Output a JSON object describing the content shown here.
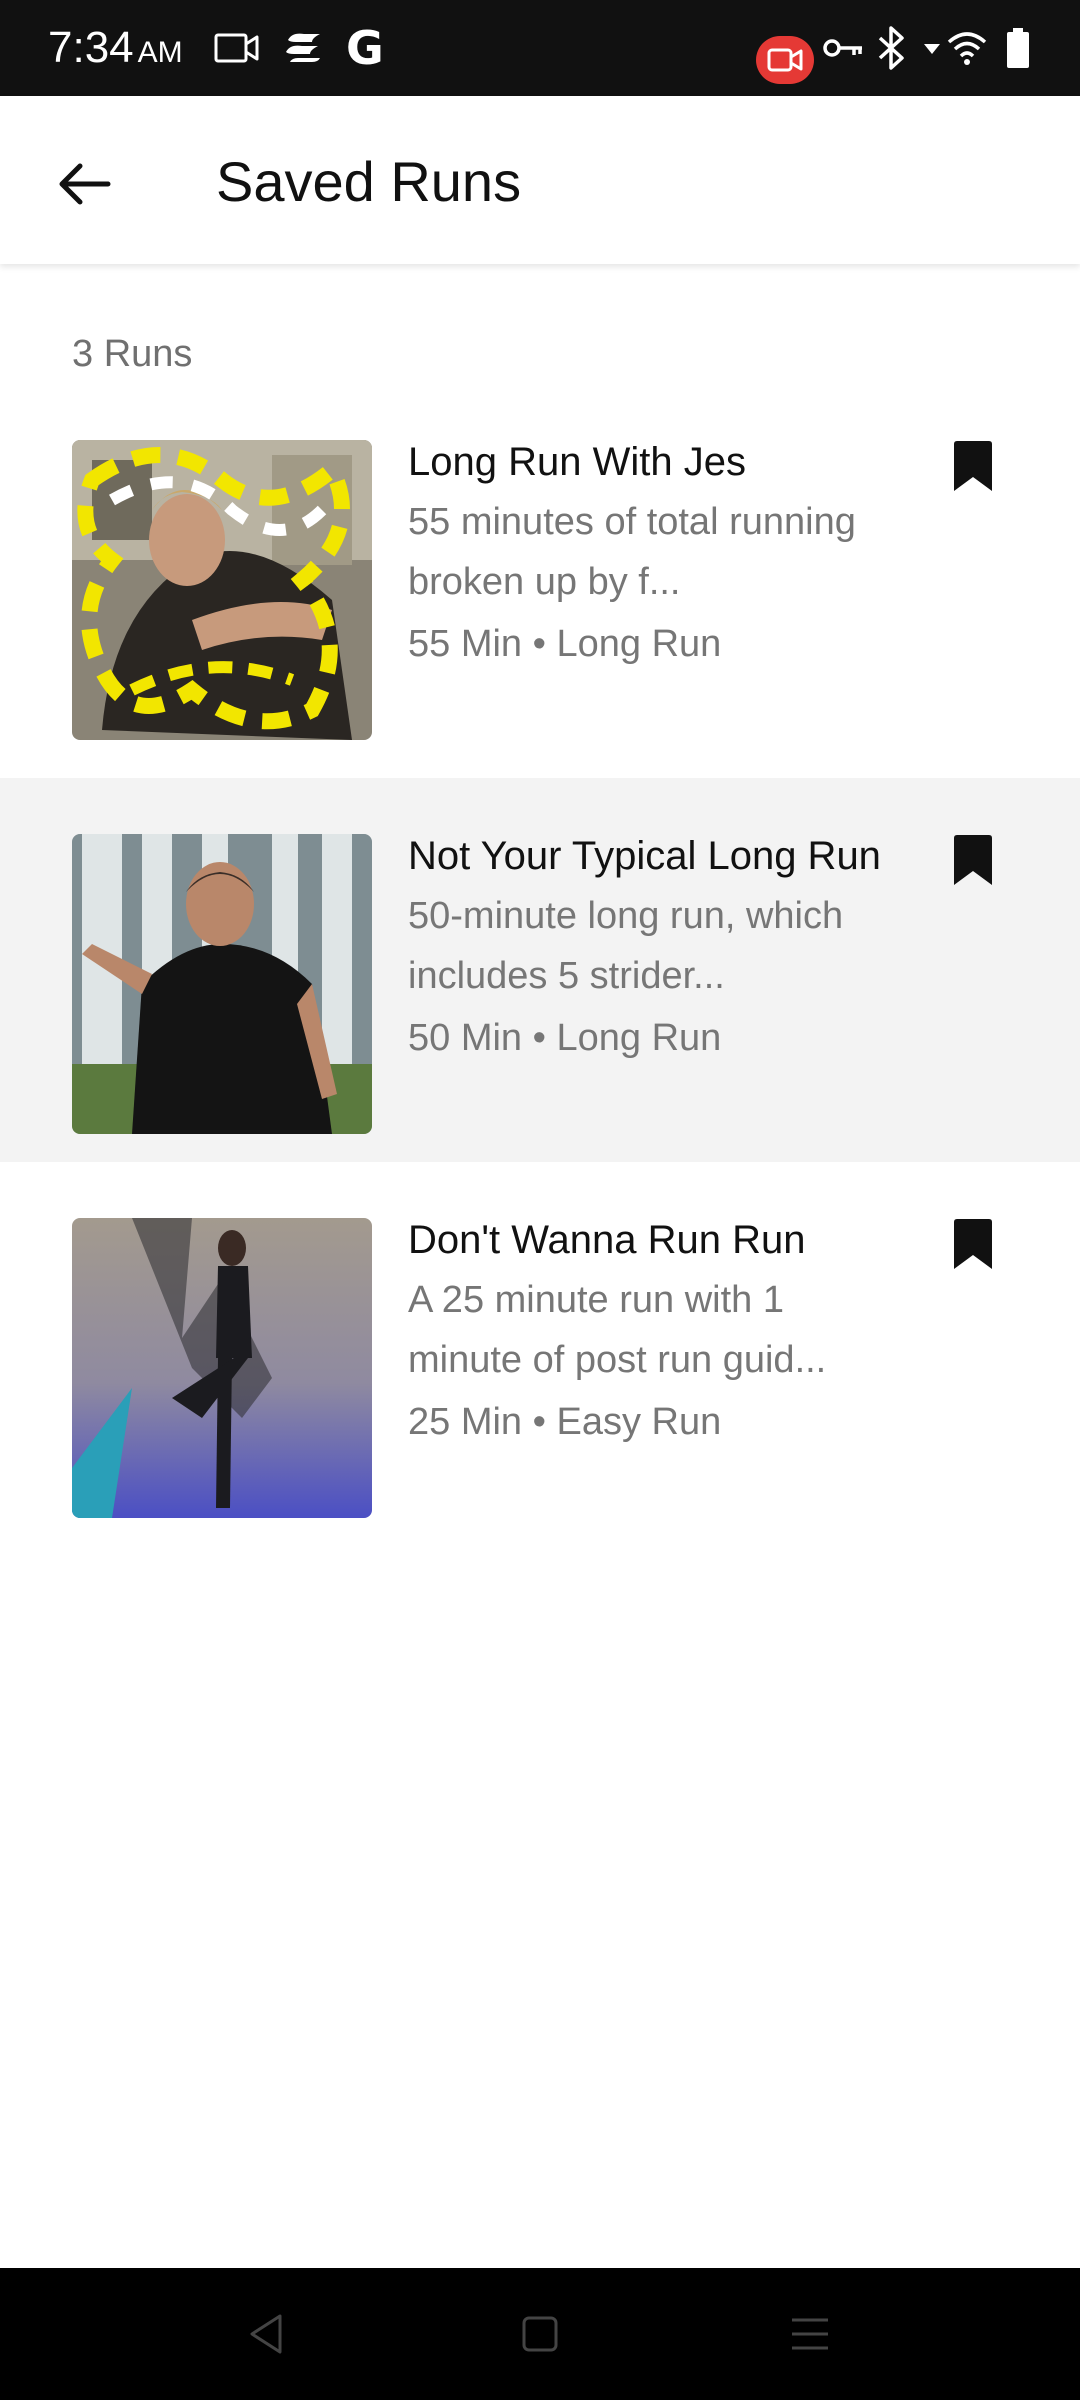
{
  "status_bar": {
    "time": "7:34",
    "ampm": "AM",
    "icons": [
      "video-camera-icon",
      "app-icon",
      "google-g-icon",
      "screen-record-icon",
      "vpn-key-icon",
      "bluetooth-icon",
      "signal-arrow-icon",
      "wifi-icon",
      "battery-icon"
    ],
    "google_letter": "G",
    "record_color": "#e53935"
  },
  "app_bar": {
    "title": "Saved Runs",
    "back_icon": "arrow-left-icon"
  },
  "content": {
    "run_count": "3 Runs",
    "runs": [
      {
        "title": "Long Run With Jes",
        "description": "55 minutes of total running broken up by f...",
        "meta": "55 Min • Long Run",
        "bookmarked": true,
        "thumbnail": "long-run-with-jes-thumbnail"
      },
      {
        "title": "Not Your Typical Long Run",
        "description": "50-minute long run, which includes 5 strider...",
        "meta": "50 Min • Long Run",
        "bookmarked": true,
        "thumbnail": "not-your-typical-long-run-thumbnail"
      },
      {
        "title": "Don't Wanna Run Run",
        "description": "A 25 minute run with 1 minute of post run guid...",
        "meta": "25 Min • Easy Run",
        "bookmarked": true,
        "thumbnail": "dont-wanna-run-run-thumbnail"
      }
    ]
  },
  "nav_bar": {
    "buttons": [
      "back-triangle-icon",
      "home-square-icon",
      "menu-lines-icon"
    ]
  },
  "colors": {
    "accent_yellow": "#f2e600",
    "text_primary": "#111111",
    "text_secondary": "#767676",
    "highlight_row": "#f3f3f3"
  }
}
